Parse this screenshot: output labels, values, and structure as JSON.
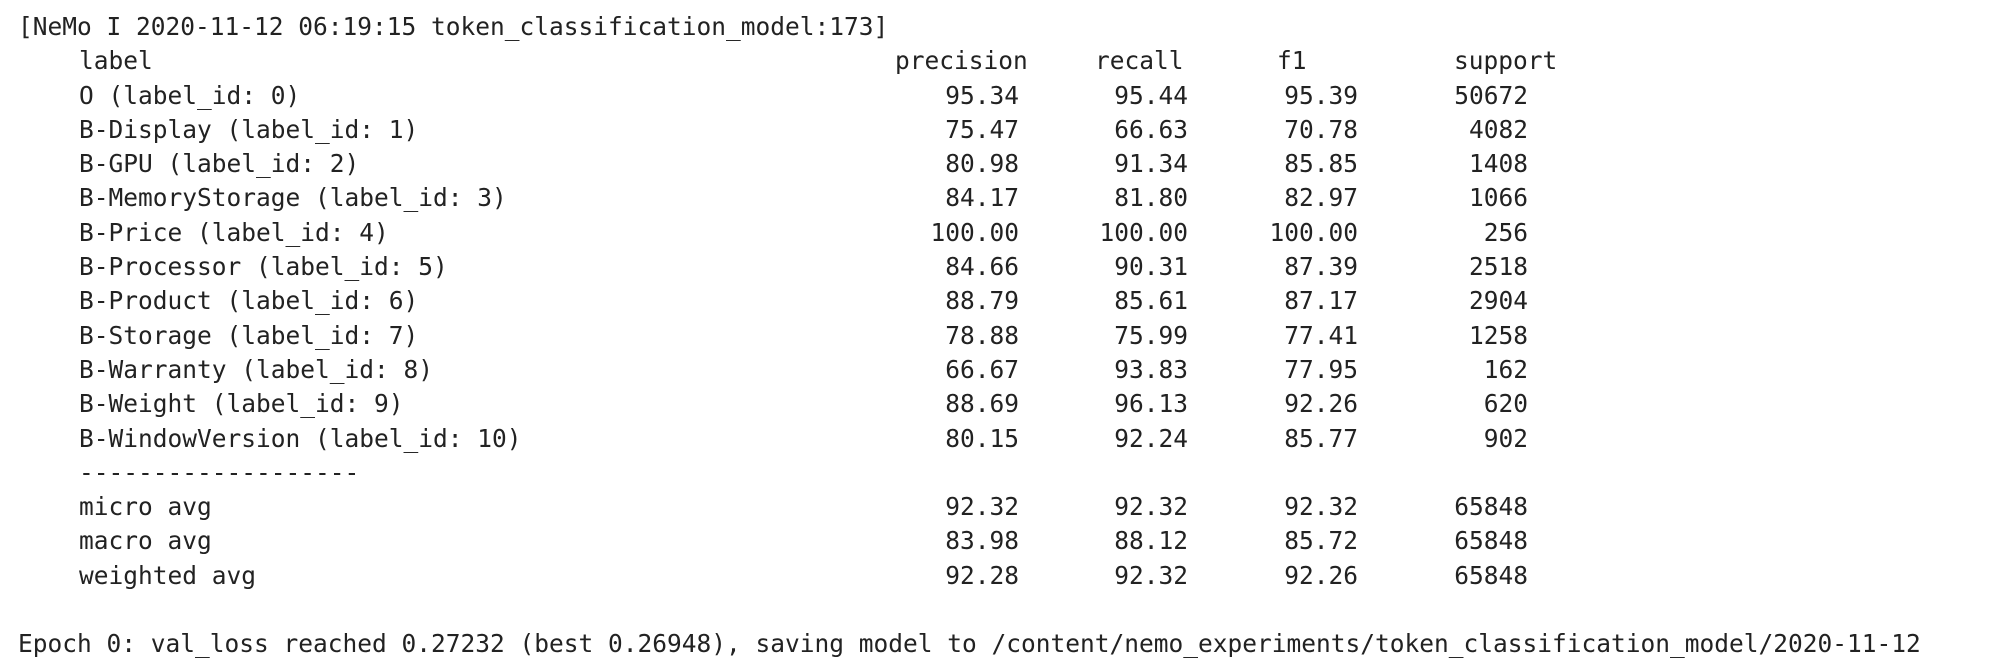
{
  "header_line": "[NeMo I 2020-11-12 06:19:15 token_classification_model:173]",
  "columns": {
    "label": "label",
    "precision": "precision",
    "recall": "recall",
    "f1": "f1",
    "support": "support"
  },
  "rows": [
    {
      "label": "O (label_id: 0)",
      "precision": "95.34",
      "recall": "95.44",
      "f1": "95.39",
      "support": "50672"
    },
    {
      "label": "B-Display (label_id: 1)",
      "precision": "75.47",
      "recall": "66.63",
      "f1": "70.78",
      "support": "4082"
    },
    {
      "label": "B-GPU (label_id: 2)",
      "precision": "80.98",
      "recall": "91.34",
      "f1": "85.85",
      "support": "1408"
    },
    {
      "label": "B-MemoryStorage (label_id: 3)",
      "precision": "84.17",
      "recall": "81.80",
      "f1": "82.97",
      "support": "1066"
    },
    {
      "label": "B-Price (label_id: 4)",
      "precision": "100.00",
      "recall": "100.00",
      "f1": "100.00",
      "support": "256"
    },
    {
      "label": "B-Processor (label_id: 5)",
      "precision": "84.66",
      "recall": "90.31",
      "f1": "87.39",
      "support": "2518"
    },
    {
      "label": "B-Product (label_id: 6)",
      "precision": "88.79",
      "recall": "85.61",
      "f1": "87.17",
      "support": "2904"
    },
    {
      "label": "B-Storage (label_id: 7)",
      "precision": "78.88",
      "recall": "75.99",
      "f1": "77.41",
      "support": "1258"
    },
    {
      "label": "B-Warranty (label_id: 8)",
      "precision": "66.67",
      "recall": "93.83",
      "f1": "77.95",
      "support": "162"
    },
    {
      "label": "B-Weight (label_id: 9)",
      "precision": "88.69",
      "recall": "96.13",
      "f1": "92.26",
      "support": "620"
    },
    {
      "label": "B-WindowVersion (label_id: 10)",
      "precision": "80.15",
      "recall": "92.24",
      "f1": "85.77",
      "support": "902"
    }
  ],
  "separator": "-------------------",
  "averages": [
    {
      "label": "micro avg",
      "precision": "92.32",
      "recall": "92.32",
      "f1": "92.32",
      "support": "65848"
    },
    {
      "label": "macro avg",
      "precision": "83.98",
      "recall": "88.12",
      "f1": "85.72",
      "support": "65848"
    },
    {
      "label": "weighted avg",
      "precision": "92.28",
      "recall": "92.32",
      "f1": "92.26",
      "support": "65848"
    }
  ],
  "epoch_line": "Epoch 0: val_loss reached 0.27232 (best 0.26948), saving model to /content/nemo_experiments/token_classification_model/2020-11-12"
}
